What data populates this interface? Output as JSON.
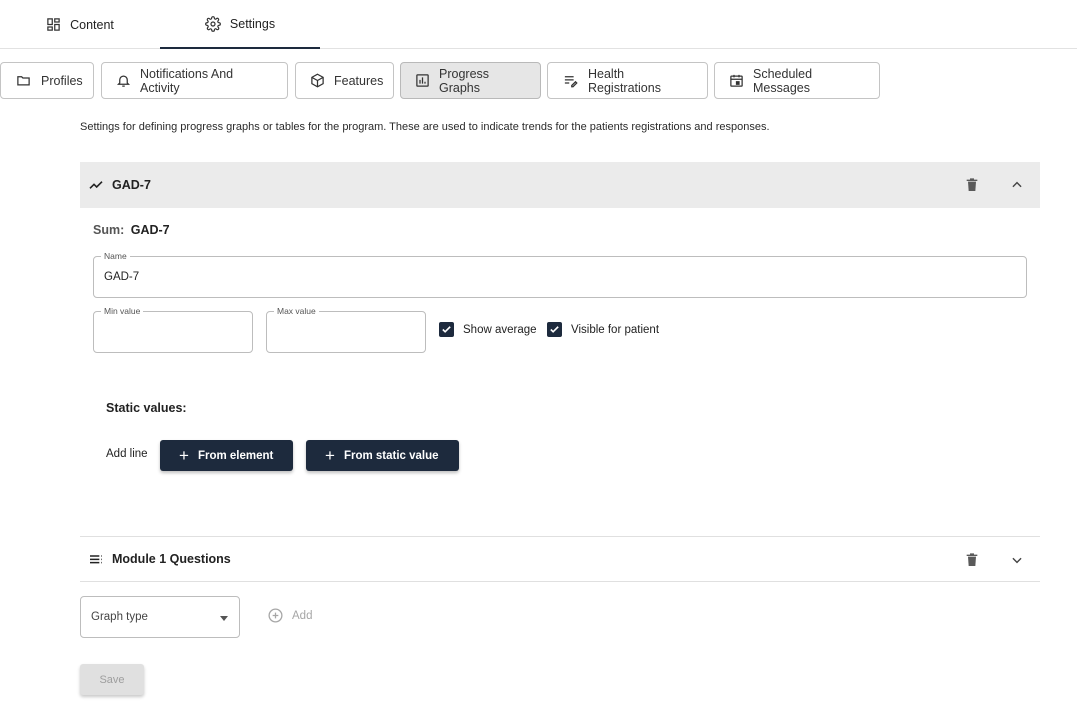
{
  "top_tabs": [
    {
      "label": "Content",
      "icon": "dashboard-icon"
    },
    {
      "label": "Settings",
      "icon": "gear-icon",
      "active": true
    }
  ],
  "sub_tabs": [
    {
      "label": "Profiles",
      "icon": "folder-icon"
    },
    {
      "label": "Notifications And Activity",
      "icon": "bell-icon"
    },
    {
      "label": "Features",
      "icon": "cube-icon"
    },
    {
      "label": "Progress Graphs",
      "icon": "bar-chart-icon",
      "active": true
    },
    {
      "label": "Health Registrations",
      "icon": "edit-list-icon"
    },
    {
      "label": "Scheduled Messages",
      "icon": "calendar-icon"
    }
  ],
  "description": "Settings for defining progress graphs or tables for the program. These are used to indicate trends for the patients registrations and responses.",
  "graphs": [
    {
      "title": "GAD-7",
      "icon": "trending-line-icon",
      "expanded": true,
      "sum_label": "Sum:",
      "sum_value": "GAD-7",
      "name_label": "Name",
      "name_value": "GAD-7",
      "min_label": "Min value",
      "min_value": "",
      "max_label": "Max value",
      "max_value": "",
      "show_average_label": "Show average",
      "show_average": true,
      "visible_label": "Visible for patient",
      "visible_for_patient": true,
      "static_values_title": "Static values:",
      "add_line_label": "Add line",
      "from_element_label": "From element",
      "from_static_label": "From static value"
    },
    {
      "title": "Module 1 Questions",
      "icon": "list-icon",
      "expanded": false
    }
  ],
  "graph_type_placeholder": "Graph type",
  "add_label": "Add",
  "save_label": "Save",
  "colors": {
    "primary": "#1d2a3d",
    "active_tab_bg": "#e6e6e6",
    "accordion_bg": "#ebebeb",
    "disabled_text": "#9e9e9e"
  }
}
